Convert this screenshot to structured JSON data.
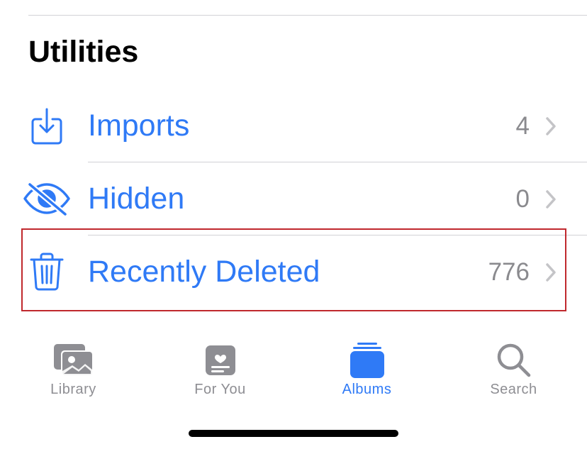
{
  "section": {
    "title": "Utilities"
  },
  "rows": [
    {
      "label": "Imports",
      "count": "4",
      "icon": "import-icon"
    },
    {
      "label": "Hidden",
      "count": "0",
      "icon": "eye-slash-icon"
    },
    {
      "label": "Recently Deleted",
      "count": "776",
      "icon": "trash-icon"
    }
  ],
  "tabbar": {
    "tabs": [
      {
        "label": "Library",
        "icon": "photo-library-icon",
        "active": false
      },
      {
        "label": "For You",
        "icon": "for-you-icon",
        "active": false
      },
      {
        "label": "Albums",
        "icon": "albums-icon",
        "active": true
      },
      {
        "label": "Search",
        "icon": "search-icon",
        "active": false
      }
    ]
  },
  "colors": {
    "accent": "#2f7af6",
    "secondary_text": "#8a8a8e",
    "inactive_tab": "#8e8e93",
    "highlight": "#c0282d"
  }
}
